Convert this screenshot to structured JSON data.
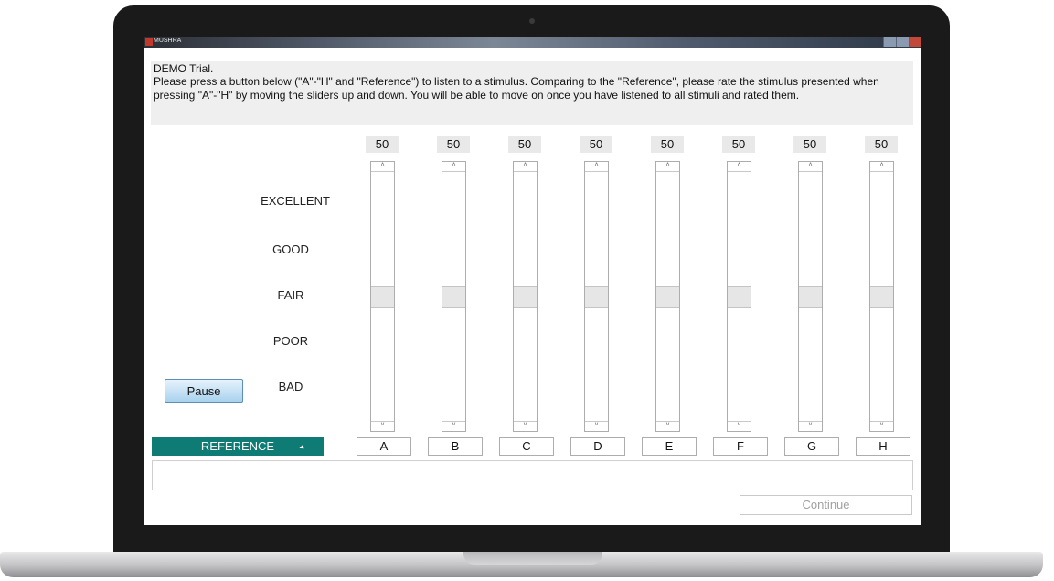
{
  "window": {
    "title": "MUSHRA"
  },
  "instructions": {
    "title": "DEMO Trial.",
    "body": "Please press a button below (\"A\"-\"H\" and \"Reference\") to listen to a stimulus. Comparing to the \"Reference\", please rate the stimulus presented when pressing \"A\"-\"H\" by moving the sliders up and down. You will be able to move on once you have listened to all stimuli and rated them."
  },
  "scale": {
    "excellent": "EXCELLENT",
    "good": "GOOD",
    "fair": "FAIR",
    "poor": "POOR",
    "bad": "BAD"
  },
  "pause_label": "Pause",
  "reference_label": "REFERENCE",
  "continue_label": "Continue",
  "slider_range": [
    0,
    100
  ],
  "sliders": [
    {
      "label": "A",
      "value": "50"
    },
    {
      "label": "B",
      "value": "50"
    },
    {
      "label": "C",
      "value": "50"
    },
    {
      "label": "D",
      "value": "50"
    },
    {
      "label": "E",
      "value": "50"
    },
    {
      "label": "F",
      "value": "50"
    },
    {
      "label": "G",
      "value": "50"
    },
    {
      "label": "H",
      "value": "50"
    }
  ],
  "colors": {
    "reference_bg": "#0e7b74",
    "pause_bg": "#a9d2ee"
  }
}
